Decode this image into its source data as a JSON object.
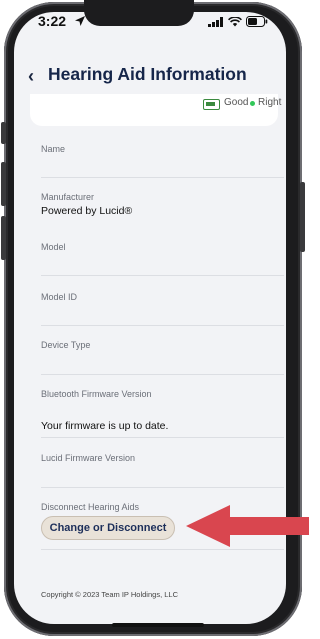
{
  "status_bar": {
    "time": "3:22",
    "icons": [
      "location-arrow-icon",
      "signal-icon",
      "wifi-icon",
      "battery-icon"
    ]
  },
  "header": {
    "back_icon": "‹",
    "title": "Hearing Aid Information"
  },
  "battery_card": {
    "status_text": "Good",
    "side_label": "Right",
    "colors": {
      "battery": "#3b8a3f",
      "dot": "#32c759"
    }
  },
  "fields": [
    {
      "label": "Name",
      "value": ""
    },
    {
      "label": "Manufacturer",
      "value": "Powered by Lucid®"
    },
    {
      "label": "Model",
      "value": ""
    },
    {
      "label": "Model ID",
      "value": ""
    },
    {
      "label": "Device Type",
      "value": ""
    },
    {
      "label": "Bluetooth Firmware Version",
      "value": "Your firmware is up to date."
    },
    {
      "label": "Lucid Firmware Version",
      "value": ""
    },
    {
      "label": "Disconnect Hearing Aids",
      "value": ""
    }
  ],
  "actions": {
    "change_or_disconnect": "Change or Disconnect"
  },
  "footer": {
    "copyright": "Copyright © 2023 Team IP Holdings, LLC"
  },
  "colors": {
    "title": "#16264a",
    "button_bg": "#e9e2d8",
    "annotation_arrow": "#d9464f"
  }
}
